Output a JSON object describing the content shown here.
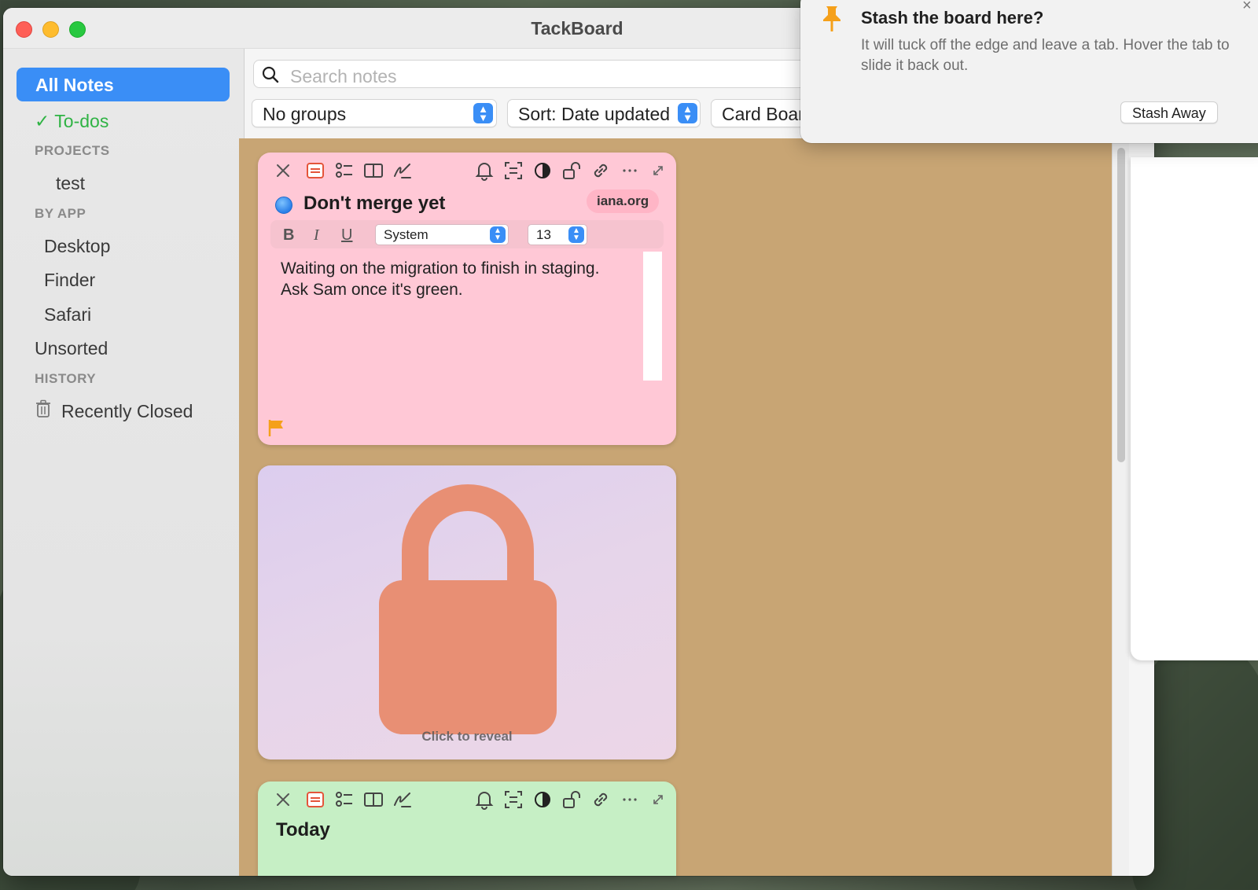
{
  "window": {
    "title": "TackBoard"
  },
  "sidebar": {
    "all_notes": "All Notes",
    "todos": "To-dos",
    "todos_check": "✓",
    "sections": {
      "projects": "PROJECTS",
      "by_app": "BY APP",
      "history": "HISTORY"
    },
    "projects": [
      "test"
    ],
    "apps": [
      "Desktop",
      "Finder",
      "Safari"
    ],
    "unsorted": "Unsorted",
    "recently_closed": "Recently Closed"
  },
  "toolbar": {
    "search_placeholder": "Search notes",
    "group_select": "No groups",
    "sort_select": "Sort: Date updated",
    "view_select": "Card Boar"
  },
  "cards": [
    {
      "title": "Don't merge yet",
      "source_app_icon": "safari-icon",
      "source": "iana.org",
      "color": "#ffc8d6",
      "format": {
        "bold": "B",
        "italic": "I",
        "underline": "U",
        "font": "System",
        "size": "13"
      },
      "body_line1": "Waiting on the migration to finish in staging.",
      "body_line2": "Ask Sam once it's green.",
      "flagged": true
    },
    {
      "locked": true,
      "reveal_label": "Click to reveal",
      "lock_color": "#e88f74"
    },
    {
      "title": "Today",
      "color": "#c6efc5"
    }
  ],
  "popover": {
    "title": "Stash the board here?",
    "body": "It will tuck off the edge and leave a tab. Hover the tab to slide it back out.",
    "button": "Stash Away",
    "close": "×",
    "icon": "pin-icon"
  },
  "colors": {
    "accent": "#3a8ef6",
    "todos_green": "#2fb344",
    "board_bg": "#c8a574",
    "pin_orange": "#f5a01a"
  }
}
